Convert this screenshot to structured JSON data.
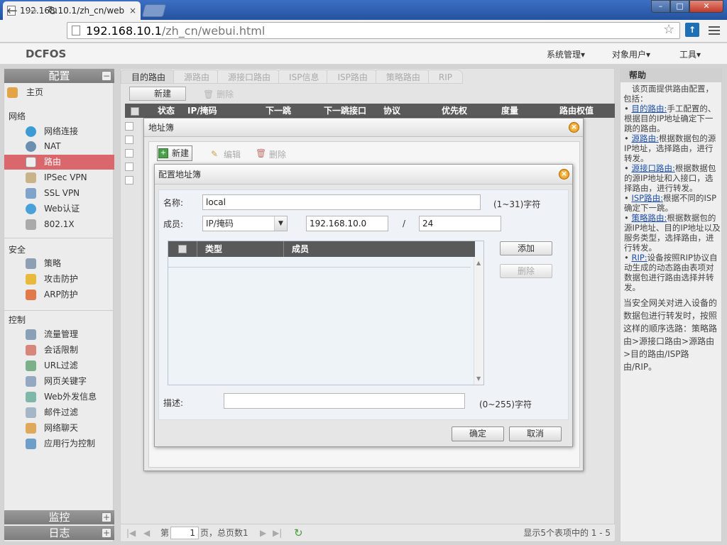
{
  "browser": {
    "tab_title": "192.168.10.1/zh_cn/web",
    "tab_close": "×",
    "url_host": "192.168.10.1",
    "url_path": "/zh_cn/webui.html",
    "window_buttons": [
      "–",
      "□",
      "✕"
    ]
  },
  "app": {
    "logo": "DCFOS",
    "top_menu": [
      "系统管理",
      "对象用户",
      "工具"
    ]
  },
  "sidebar": {
    "header": "配置",
    "home": "主页",
    "sections": [
      {
        "title": "网络",
        "items": [
          "网络连接",
          "NAT",
          "路由",
          "IPSec VPN",
          "SSL VPN",
          "Web认证",
          "802.1X"
        ]
      },
      {
        "title": "安全",
        "items": [
          "策略",
          "攻击防护",
          "ARP防护"
        ]
      },
      {
        "title": "控制",
        "items": [
          "流量管理",
          "会话限制",
          "URL过滤",
          "网页关键字",
          "Web外发信息",
          "邮件过滤",
          "网络聊天",
          "应用行为控制"
        ]
      }
    ],
    "active_item": "路由",
    "footer": [
      "监控",
      "日志"
    ]
  },
  "main": {
    "tabs": [
      "目的路由",
      "源路由",
      "源接口路由",
      "ISP信息",
      "ISP路由",
      "策略路由",
      "RIP"
    ],
    "toolbar": {
      "new": "新建",
      "delete": "删除"
    },
    "table_headers": [
      "状态",
      "IP/掩码",
      "下一跳",
      "下一跳接口",
      "协议",
      "优先权",
      "度量",
      "路由权值"
    ],
    "pager": {
      "page_prefix": "第",
      "page_value": "1",
      "page_suffix": "页，总页数1",
      "summary": "显示5个表项中的 1 - 5"
    }
  },
  "help": {
    "title": "帮助",
    "intro": "该页面提供路由配置，包括：",
    "items": [
      {
        "link": "目的路由:",
        "text": "手工配置的、根据目的IP地址确定下一跳的路由。"
      },
      {
        "link": "源路由:",
        "text": "根据数据包的源IP地址，选择路由，进行转发。"
      },
      {
        "link": "源接口路由:",
        "text": "根据数据包的源IP地址和入接口，选择路由，进行转发。"
      },
      {
        "link": "ISP路由:",
        "text": "根据不同的ISP确定下一跳。"
      },
      {
        "link": "策略路由:",
        "text": "根据数据包的源IP地址、目的IP地址以及服务类型，选择路由，进行转发。"
      },
      {
        "link": "RIP:",
        "text": "设备按照RIP协议自动生成的动态路由表项对数据包进行路由选择并转发。"
      }
    ],
    "tail": "当安全网关对进入设备的数据包进行转发时，按照这样的顺序选路：策略路由>源接口路由>源路由>目的路由/ISP路由/RIP。"
  },
  "dialog_addrbook": {
    "title": "地址簿",
    "toolbar": {
      "new": "新建",
      "edit": "编辑",
      "delete": "删除"
    }
  },
  "dialog_config": {
    "title": "配置地址簿",
    "name_label": "名称:",
    "name_value": "local",
    "name_hint": "(1~31)字符",
    "member_label": "成员:",
    "member_type": "IP/掩码",
    "member_ip": "192.168.10.0",
    "slash": "/",
    "member_mask": "24",
    "table_headers": [
      "类型",
      "成员"
    ],
    "add_button": "添加",
    "delete_button": "删除",
    "desc_label": "描述:",
    "desc_value": "",
    "desc_hint": "(0~255)字符",
    "ok_button": "确定",
    "cancel_button": "取消"
  },
  "colors": {
    "active_nav": "#d9676b",
    "link": "#1e4fa8",
    "table_header": "#595959"
  }
}
